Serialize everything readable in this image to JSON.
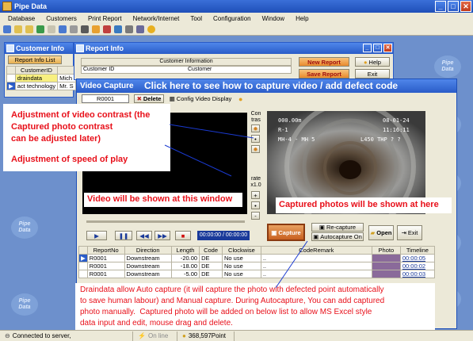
{
  "app": {
    "title": "Pipe Data",
    "logo_text": "Pipe\nData"
  },
  "menu": [
    "Database",
    "Customers",
    "Print Report",
    "Network/Internet",
    "Tool",
    "Configuration",
    "Window",
    "Help"
  ],
  "customer_info": {
    "title": "Customer Info",
    "report_info_list_label": "Report Info List",
    "column_header": "CustomerID",
    "rows": [
      {
        "id": "draindata",
        "name": "Mich"
      },
      {
        "id": "act technology",
        "name": "Mr. S"
      }
    ]
  },
  "report_info": {
    "title": "Report Info",
    "section_label": "Customer Information",
    "customer_id_label": "Customer ID",
    "customer_label": "Customer",
    "new_report_label": "New Report",
    "save_report_label": "Save Report",
    "help_label": "Help",
    "exit_label": "Exit"
  },
  "video_capture": {
    "title": "Video Capture",
    "banner": "Click here to see how to capture video / add defect code",
    "code_value": "R0001",
    "delete_label": "Delete",
    "config_label": "Config Video Display",
    "contrast_label": "Con\ntras",
    "rate_label": "rate\nx1.0",
    "time_display": "00:00:00 / 00:00:00",
    "capture_label": "Capture",
    "recapture_label": "Re-capture",
    "autocapture_label": "Autocapture On",
    "open_label": "Open",
    "exit_label": "Exit",
    "overlay": {
      "distance": "000.00m",
      "date": "08-01-24",
      "line2": "R-1",
      "time": "11:16:11",
      "line3": "MH-4 - MH 5",
      "line3b": "L450 THP  ? ?"
    }
  },
  "defect_table": {
    "headers": [
      "ReportNo",
      "Direction",
      "Length",
      "Code",
      "Clockwise",
      "CodeRemark",
      "Photo",
      "Timeline"
    ],
    "rows": [
      {
        "no": "R0001",
        "dir": "Downstream",
        "len": "-20.00",
        "code": "DE",
        "clock": "No use",
        "remark": "..",
        "time": "00:00:05"
      },
      {
        "no": "R0001",
        "dir": "Downstream",
        "len": "-18.00",
        "code": "DE",
        "clock": "No use",
        "remark": "..",
        "time": "00:00:02"
      },
      {
        "no": "R0001",
        "dir": "Downstream",
        "len": "-5.00",
        "code": "DE",
        "clock": "No use",
        "remark": "..",
        "time": "00:00:03"
      }
    ]
  },
  "callouts": {
    "contrast": "Adjustment of video contrast (the\nCaptured photo contrast\ncan be adjusted later)",
    "speed": "Adjustment of speed of play",
    "video_window": "Video will be shown at this window",
    "photos": "Captured photos will be shown at here",
    "description": "Draindata allow Auto capture (it will capture the photo with defected point automatically\nto save human labour) and Manual capture. During Autocapture, You can add captured\nphoto manually.  Captured photo will be added on below list to allow MS Excel style\ndata input and edit, mouse drag and delete."
  },
  "status": {
    "connection": "Connected to server,",
    "online": "On line",
    "points": "368,597Point"
  },
  "colors": {
    "accent": "#2a5cc8",
    "callout_text": "#e8101a",
    "banner_text": "#ffffff"
  }
}
